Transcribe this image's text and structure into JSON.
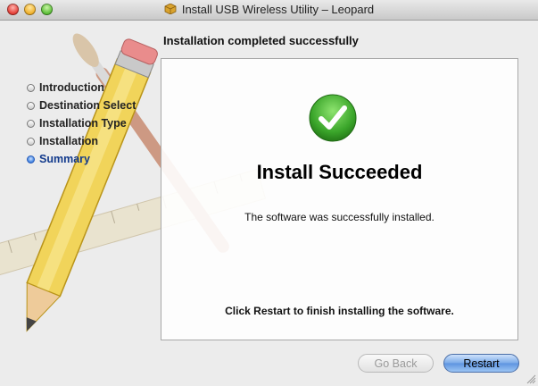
{
  "window": {
    "title": "Install USB Wireless Utility – Leopard",
    "app_icon": "package-icon"
  },
  "header": {
    "status": "Installation completed successfully"
  },
  "sidebar": {
    "steps": [
      {
        "label": "Introduction",
        "active": false
      },
      {
        "label": "Destination Select",
        "active": false
      },
      {
        "label": "Installation Type",
        "active": false
      },
      {
        "label": "Installation",
        "active": false
      },
      {
        "label": "Summary",
        "active": true
      }
    ]
  },
  "main": {
    "result_icon": "checkmark-icon",
    "title": "Install Succeeded",
    "message": "The software was successfully installed.",
    "restart_message": "Click Restart to finish installing the software."
  },
  "buttons": {
    "back_label": "Go Back",
    "restart_label": "Restart"
  },
  "colors": {
    "accent": "#5d93e0",
    "success": "#3aa52a",
    "active_step": "#123a8c"
  }
}
